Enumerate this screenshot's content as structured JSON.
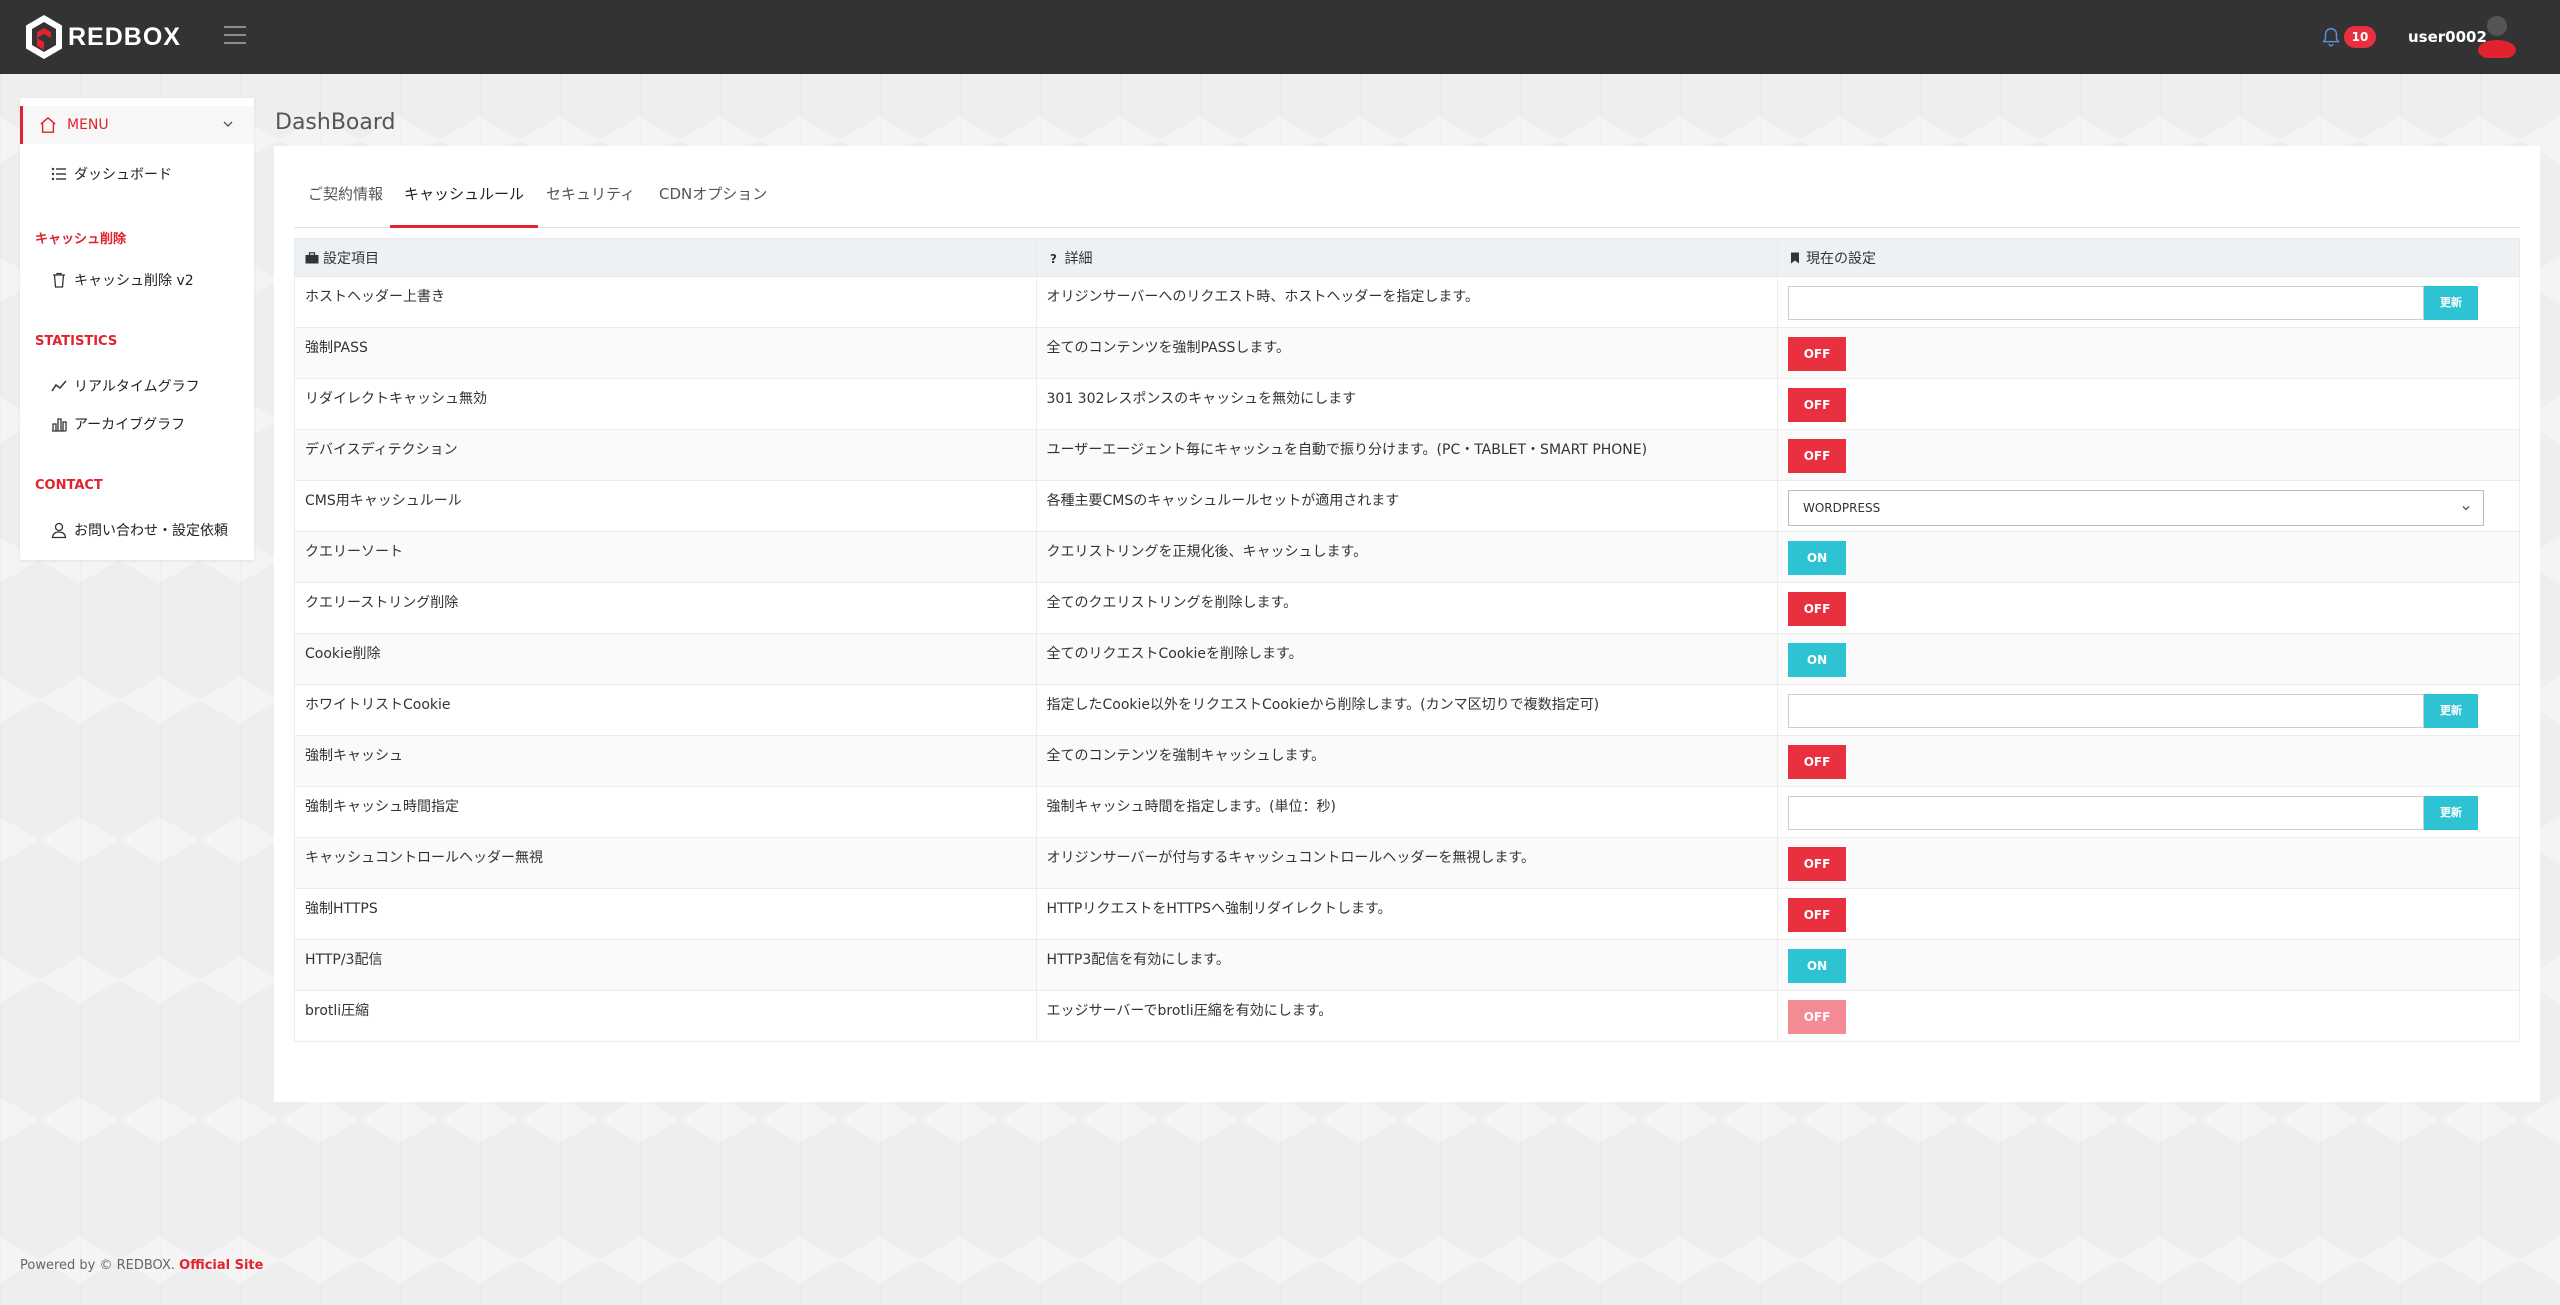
{
  "brand": {
    "name": "REDBOX"
  },
  "header": {
    "notification_count": "10",
    "username": "user0002"
  },
  "sidebar": {
    "menu_label": "MENU",
    "items": [
      {
        "label": "ダッシュボード"
      },
      {
        "section": "キャッシュ削除"
      },
      {
        "label": "キャッシュ削除 v2"
      },
      {
        "section": "STATISTICS"
      },
      {
        "label": "リアルタイムグラフ"
      },
      {
        "label": "アーカイブグラフ"
      },
      {
        "section": "CONTACT"
      },
      {
        "label": "お問い合わせ・設定依頼"
      }
    ]
  },
  "page": {
    "title": "DashBoard"
  },
  "tabs": [
    {
      "label": "ご契約情報",
      "active": false
    },
    {
      "label": "キャッシュルール",
      "active": true
    },
    {
      "label": "セキュリティ",
      "active": false
    },
    {
      "label": "CDNオプション",
      "active": false
    }
  ],
  "table": {
    "headers": [
      "設定項目",
      "詳細",
      "現在の設定"
    ],
    "rows": [
      {
        "name": "ホストヘッダー上書き",
        "detail": "オリジンサーバーへのリクエスト時、ホストヘッダーを指定します。",
        "control": "input",
        "button": "更新"
      },
      {
        "name": "強制PASS",
        "detail": "全てのコンテンツを強制PASSします。",
        "control": "toggle",
        "state": "OFF"
      },
      {
        "name": "リダイレクトキャッシュ無効",
        "detail": "301 302レスポンスのキャッシュを無効にします",
        "control": "toggle",
        "state": "OFF"
      },
      {
        "name": "デバイスディテクション",
        "detail": "ユーザーエージェント毎にキャッシュを自動で振り分けます。(PC・TABLET・SMART PHONE)",
        "control": "toggle",
        "state": "OFF"
      },
      {
        "name": "CMS用キャッシュルール",
        "detail": "各種主要CMSのキャッシュルールセットが適用されます",
        "control": "select",
        "value": "WORDPRESS"
      },
      {
        "name": "クエリーソート",
        "detail": "クエリストリングを正規化後、キャッシュします。",
        "control": "toggle",
        "state": "ON"
      },
      {
        "name": "クエリーストリング削除",
        "detail": "全てのクエリストリングを削除します。",
        "control": "toggle",
        "state": "OFF"
      },
      {
        "name": "Cookie削除",
        "detail": "全てのリクエストCookieを削除します。",
        "control": "toggle",
        "state": "ON"
      },
      {
        "name": "ホワイトリストCookie",
        "detail": "指定したCookie以外をリクエストCookieから削除します。(カンマ区切りで複数指定可)",
        "control": "input",
        "button": "更新"
      },
      {
        "name": "強制キャッシュ",
        "detail": "全てのコンテンツを強制キャッシュします。",
        "control": "toggle",
        "state": "OFF"
      },
      {
        "name": "強制キャッシュ時間指定",
        "detail": "強制キャッシュ時間を指定します。(単位：秒)",
        "control": "input",
        "button": "更新"
      },
      {
        "name": "キャッシュコントロールヘッダー無視",
        "detail": "オリジンサーバーが付与するキャッシュコントロールヘッダーを無視します。",
        "control": "toggle",
        "state": "OFF"
      },
      {
        "name": "強制HTTPS",
        "detail": "HTTPリクエストをHTTPSへ強制リダイレクトします。",
        "control": "toggle",
        "state": "OFF"
      },
      {
        "name": "HTTP/3配信",
        "detail": "HTTP3配信を有効にします。",
        "control": "toggle",
        "state": "ON"
      },
      {
        "name": "brotli圧縮",
        "detail": "エッジサーバーでbrotli圧縮を有効にします。",
        "control": "toggle",
        "state": "OFF",
        "disabled": true
      }
    ]
  },
  "footer": {
    "text": "Powered by © REDBOX.",
    "link": "Official Site"
  },
  "colors": {
    "brand_red": "#e0232e",
    "off": "#e8303e",
    "on": "#2ec3d2",
    "topbar": "#333333"
  }
}
